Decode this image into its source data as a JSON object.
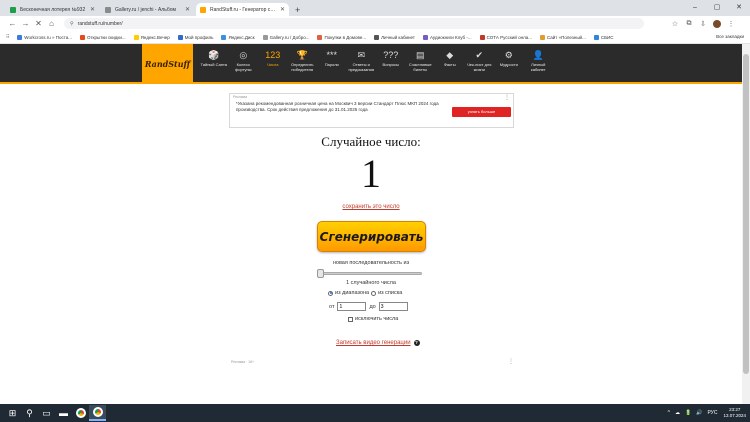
{
  "browser": {
    "tabs": [
      {
        "title": "Бесконечная лотерея №932",
        "favicon_color": "#1e9e4a",
        "active": false
      },
      {
        "title": "Gallery.ru / jenchi - Альбом",
        "favicon_color": "#8a8a8a",
        "active": false
      },
      {
        "title": "RandStuff.ru - Генератор случ...",
        "favicon_color": "#ffa500",
        "active": true
      }
    ],
    "new_tab": "+",
    "window_controls": [
      "–",
      "▢",
      "✕"
    ],
    "url": "randstuff.ru/number/",
    "bookmarks": [
      {
        "label": "Workcross.ru » Поста...",
        "color": "#3b7be0"
      },
      {
        "label": "Открытки скидки...",
        "color": "#e64a19"
      },
      {
        "label": "Яндекс.Вечер",
        "color": "#ffcc00"
      },
      {
        "label": "Мой профиль",
        "color": "#2f6bd1"
      },
      {
        "label": "Яндекс.Диск",
        "color": "#3d8fe0"
      },
      {
        "label": "Gallery.ru / Добро...",
        "color": "#999999"
      },
      {
        "label": "Покупки в Домове...",
        "color": "#e06040"
      },
      {
        "label": "Личный кабинет",
        "color": "#555555"
      },
      {
        "label": "Аудиокниги Клуб -...",
        "color": "#7a5ac8"
      },
      {
        "label": "СОТА Русский онла...",
        "color": "#c0392b"
      },
      {
        "label": "Сайт «Полезный...",
        "color": "#e69a2b"
      },
      {
        "label": "СБИС",
        "color": "#2e86de"
      }
    ],
    "all_bookmarks": "Все закладки"
  },
  "site": {
    "logo": "RandStuff",
    "nav": [
      {
        "icon": "🎲",
        "label": "Тайный Санта",
        "active": false
      },
      {
        "icon": "◎",
        "label": "Колесо фортуны",
        "active": false
      },
      {
        "icon": "123",
        "label": "Числа",
        "active": true
      },
      {
        "icon": "🏆",
        "label": "Определить победителя",
        "active": false
      },
      {
        "icon": "***",
        "label": "Пароли",
        "active": false
      },
      {
        "icon": "✉",
        "label": "Ответы и предсказания",
        "active": false
      },
      {
        "icon": "???",
        "label": "Вопросы",
        "active": false
      },
      {
        "icon": "▤",
        "label": "Счастливые билеты",
        "active": false
      },
      {
        "icon": "◆",
        "label": "Факты",
        "active": false
      },
      {
        "icon": "✔",
        "label": "Чек-лист для жизни",
        "active": false
      },
      {
        "icon": "⚙",
        "label": "Мудрости",
        "active": false
      },
      {
        "icon": "👤",
        "label": "Личный кабинет",
        "active": false
      }
    ]
  },
  "ad": {
    "label": "Реклама",
    "text": "*Указана рекомендованная розничная цена на Москвич 3 версии Стандарт Плюс МКП 2024 года производства. Срок действия предложения до 31.01.2025 года",
    "button": "узнать больше",
    "menu": "⋮"
  },
  "generator": {
    "title": "Случайное число:",
    "result": "1",
    "save_link": "сохранить это число",
    "generate_button": "Сгенерировать",
    "sequence_label": "новая последовательность из",
    "count_label": "1 случайного числа",
    "mode_range": "из диапазона",
    "mode_list": "из списка",
    "from_label": "от",
    "from_value": "1",
    "to_label": "до",
    "to_value": "3",
    "exclude_label": "исключить числа",
    "video_link": "Записать видео генерации"
  },
  "bottom_ad": {
    "label": "Реклама · 16+",
    "menu": "⋮"
  },
  "taskbar": {
    "tray": [
      "^",
      "☁",
      "🔋",
      "🔊",
      "РУС"
    ],
    "time": "23:27",
    "date": "13.07.2024"
  },
  "colors": {
    "accent": "#ffa500",
    "header_bg": "#2b2b2b",
    "link": "#c0392b"
  }
}
